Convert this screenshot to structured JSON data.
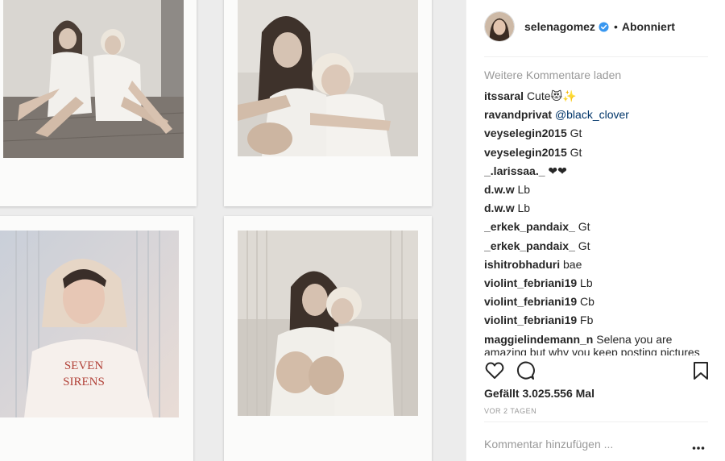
{
  "post": {
    "author": "selenagomez",
    "follow_status": "Abonniert",
    "separator": "•"
  },
  "comments_section": {
    "load_more_label": "Weitere Kommentare laden",
    "comments": [
      {
        "user": "itssaral",
        "text": "Cute😻✨"
      },
      {
        "user": "ravandprivat",
        "text": "@black_clover",
        "is_mention": true
      },
      {
        "user": "veyselegin2015",
        "text": "Gt"
      },
      {
        "user": "veyselegin2015",
        "text": "Gt"
      },
      {
        "user": "_.larissaa._",
        "text": "❤❤"
      },
      {
        "user": "d.w.w",
        "text": "Lb"
      },
      {
        "user": "d.w.w",
        "text": "Lb"
      },
      {
        "user": "_erkek_pandaix_",
        "text": "Gt"
      },
      {
        "user": "_erkek_pandaix_",
        "text": "Gt"
      },
      {
        "user": "ishitrobhaduri",
        "text": "bae"
      },
      {
        "user": "violint_febriani19",
        "text": "Lb"
      },
      {
        "user": "violint_febriani19",
        "text": "Cb"
      },
      {
        "user": "violint_febriani19",
        "text": "Fb"
      },
      {
        "user": "maggielindemann_n",
        "text": "Selena you are amazing but why you keep posting pictures"
      }
    ]
  },
  "actions": {
    "like_icon": "heart-icon",
    "comment_icon": "comment-bubble-icon",
    "save_icon": "bookmark-icon"
  },
  "likes_text": "Gefällt 3.025.556 Mal",
  "time_text": "VOR 2 TAGEN",
  "add_comment": {
    "placeholder": "Kommentar hinzufügen ...",
    "more_icon": "more-options-icon"
  },
  "colors": {
    "verified_badge": "#3897f0",
    "mention": "#003569",
    "muted_text": "#999999",
    "text": "#262626"
  },
  "photo_print_text": "SEVEN SIRENS"
}
